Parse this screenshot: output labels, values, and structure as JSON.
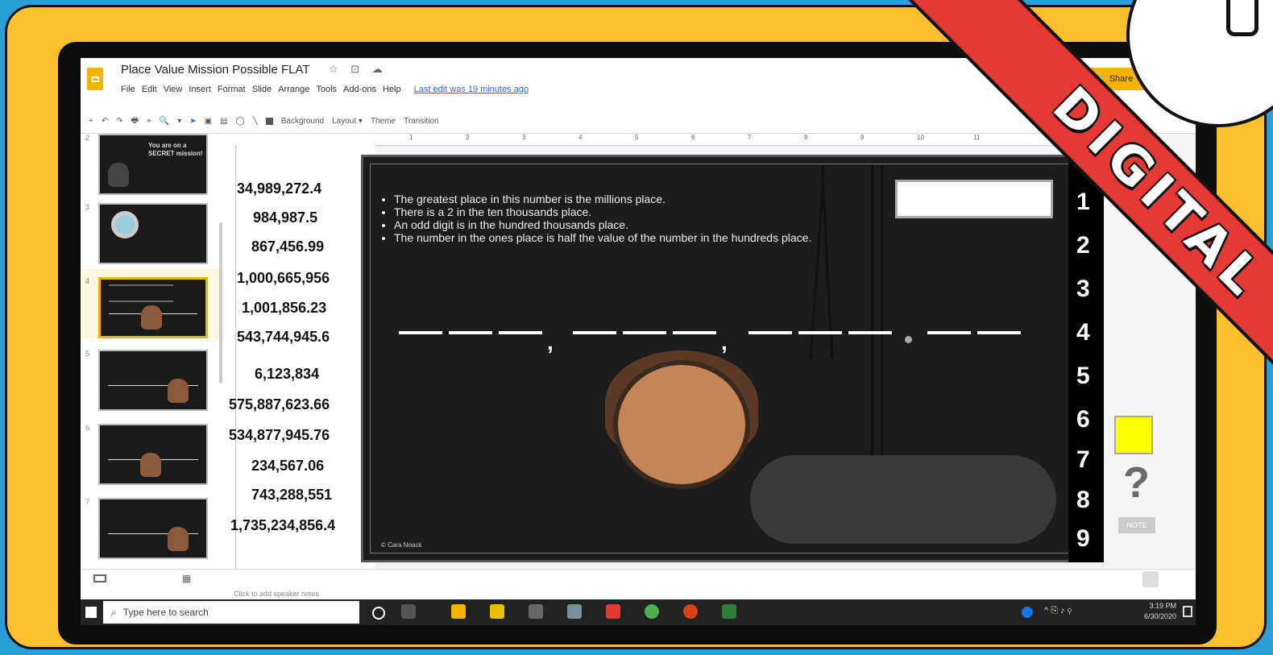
{
  "app": {
    "title": "Place Value Mission Possible FLAT",
    "title_icons": "☆ ⊡ ☁",
    "menu": [
      "File",
      "Edit",
      "View",
      "Insert",
      "Format",
      "Slide",
      "Arrange",
      "Tools",
      "Add-ons",
      "Help"
    ],
    "last_edit": "Last edit was 19 minutes ago",
    "share_label": "Share"
  },
  "toolbar": {
    "items": [
      "+",
      "↶",
      "↷",
      "🖶",
      "⌖",
      "🔍",
      "▾"
    ],
    "background_label": "Background",
    "layout_label": "Layout ▾",
    "theme_label": "Theme",
    "transition_label": "Transition"
  },
  "ruler": {
    "ticks": [
      "1",
      "2",
      "3",
      "4",
      "5",
      "6",
      "7",
      "8",
      "9",
      "10",
      "11"
    ]
  },
  "filmstrip": {
    "numbers": [
      "2",
      "3",
      "4",
      "5",
      "6",
      "7"
    ],
    "thumb2_text": "You are on a SECRET mission!"
  },
  "numbers_column": [
    "34,989,272.4",
    "984,987.5",
    "867,456.99",
    "1,000,665,956",
    "1,001,856.23",
    "543,744,945.6",
    "6,123,834",
    "575,887,623.66",
    "534,877,945.76",
    "234,567.06",
    "743,288,551",
    "1,735,234,856.4"
  ],
  "slide": {
    "clues": [
      "The greatest place in this number is the millions place.",
      "There is a 2 in the ten thousands place.",
      "An odd digit is in the hundred thousands place.",
      "The number in the ones place is half the value of the number in the hundreds place."
    ],
    "copyright": "© Cara Noack"
  },
  "digit_strip": [
    "1",
    "2",
    "3",
    "4",
    "5",
    "6",
    "7",
    "8",
    "9"
  ],
  "side": {
    "question_mark": "?",
    "note_label": "NOTE"
  },
  "speaker_notes_placeholder": "Click to add speaker notes",
  "taskbar": {
    "search_placeholder": "Type here to search",
    "time": "3:19 PM",
    "date": "6/30/2020"
  },
  "banner": {
    "text": "DIGITAL"
  },
  "colors": {
    "banner": "#e53935",
    "frame": "#fbc02d",
    "background": "#2a9fd6",
    "accent": "#f4b400"
  }
}
